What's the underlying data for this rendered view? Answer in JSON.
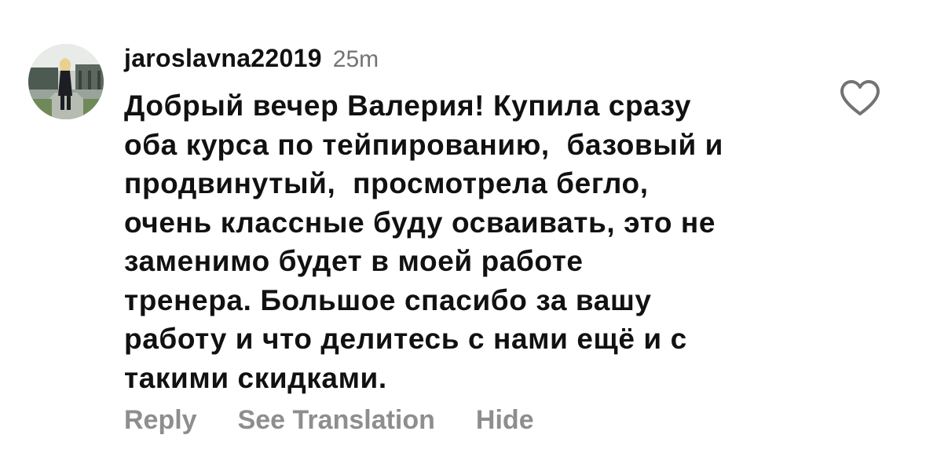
{
  "comment": {
    "username": "jaroslavna22019",
    "timestamp": "25m",
    "text_lines": [
      "Добрый вечер Валерия! Купила сразу",
      "оба курса по тейпированию,  базовый и",
      "продвинутый,  просмотрела бегло,",
      "очень классные буду осваивать, это не",
      "заменимо будет в моей работе",
      "тренера. Большое спасибо за вашу",
      "работу и что делитесь с нами ещё и с",
      "такими скидками."
    ],
    "like_icon": "heart-outline-icon",
    "actions": {
      "reply": "Reply",
      "see_translation": "See Translation",
      "hide": "Hide"
    }
  },
  "colors": {
    "text": "#111111",
    "secondary": "#737373",
    "action": "#8e8e8e",
    "background": "#ffffff"
  }
}
